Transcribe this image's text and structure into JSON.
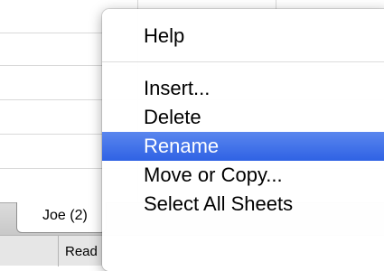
{
  "sheet_tabs": [
    {
      "label": "Joe (2)"
    }
  ],
  "status_bar": {
    "text": "Read"
  },
  "context_menu": {
    "items": [
      {
        "label": "Help"
      },
      {
        "label": "Insert..."
      },
      {
        "label": "Delete"
      },
      {
        "label": "Rename",
        "selected": true
      },
      {
        "label": "Move or Copy..."
      },
      {
        "label": "Select All Sheets"
      }
    ]
  },
  "colors": {
    "selection": "#3a6ae6",
    "menu_background": "#ffffff",
    "tab_bar": "#d0d0d0"
  }
}
